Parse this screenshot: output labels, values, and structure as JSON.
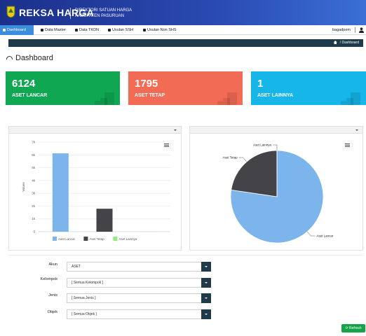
{
  "header": {
    "brand": "REKSA HARGA",
    "subtitle_line1": "DIREKTORI SATUAN HARGA",
    "subtitle_line2": "KABUPATEN PASURUAN"
  },
  "nav": {
    "items": [
      {
        "label": "Dashboard",
        "active": true
      },
      {
        "label": "Data Master"
      },
      {
        "label": "Data TKDN"
      },
      {
        "label": "Usulan SSH"
      },
      {
        "label": "Usulan Non SHS"
      }
    ],
    "user": "bagadpem"
  },
  "breadcrumb": {
    "current": "Dashboard"
  },
  "page": {
    "title": "Dashboard"
  },
  "stats": [
    {
      "value": "6124",
      "label": "ASET LANCAR",
      "color": "#10a753"
    },
    {
      "value": "1795",
      "label": "ASET TETAP",
      "color": "#f26b55"
    },
    {
      "value": "1",
      "label": "ASET LAINNYA",
      "color": "#16b6e8"
    }
  ],
  "chart_data": [
    {
      "type": "bar",
      "categories": [
        "Aset Lancar",
        "Aset Tetap",
        "Aset Lainnya"
      ],
      "values": [
        6124,
        1795,
        1
      ],
      "colors": [
        "#7cb5ec",
        "#434348",
        "#90ed7d"
      ],
      "ylabel": "Values",
      "ylim": [
        0,
        7000
      ],
      "yticks": [
        "0",
        "1k",
        "2k",
        "3k",
        "4k",
        "5k",
        "6k",
        "7k"
      ],
      "grid": true,
      "legend": "bottom"
    },
    {
      "type": "pie",
      "categories": [
        "Aset Lancar",
        "Aset Tetap",
        "Aset Lainnya"
      ],
      "values": [
        6124,
        1795,
        1
      ],
      "colors": [
        "#7cb5ec",
        "#434348",
        "#90ed7d"
      ],
      "labels_shown": [
        "Aset Lainnya",
        "Aset Tetap",
        "Aset Lancar"
      ]
    }
  ],
  "filters": [
    {
      "label": "Akun",
      "value": "ASET"
    },
    {
      "label": "Kelompok",
      "value": "[ Semua Kelompok ]"
    },
    {
      "label": "Jenis",
      "value": "[ Semua Jenis ]"
    },
    {
      "label": "Objek",
      "value": "[ Semua Objek ]"
    }
  ],
  "refresh_label": "Refresh",
  "icons": [
    "gauge-icon",
    "home-icon",
    "user-icon",
    "hamburger-menu-icon",
    "refresh-icon"
  ]
}
